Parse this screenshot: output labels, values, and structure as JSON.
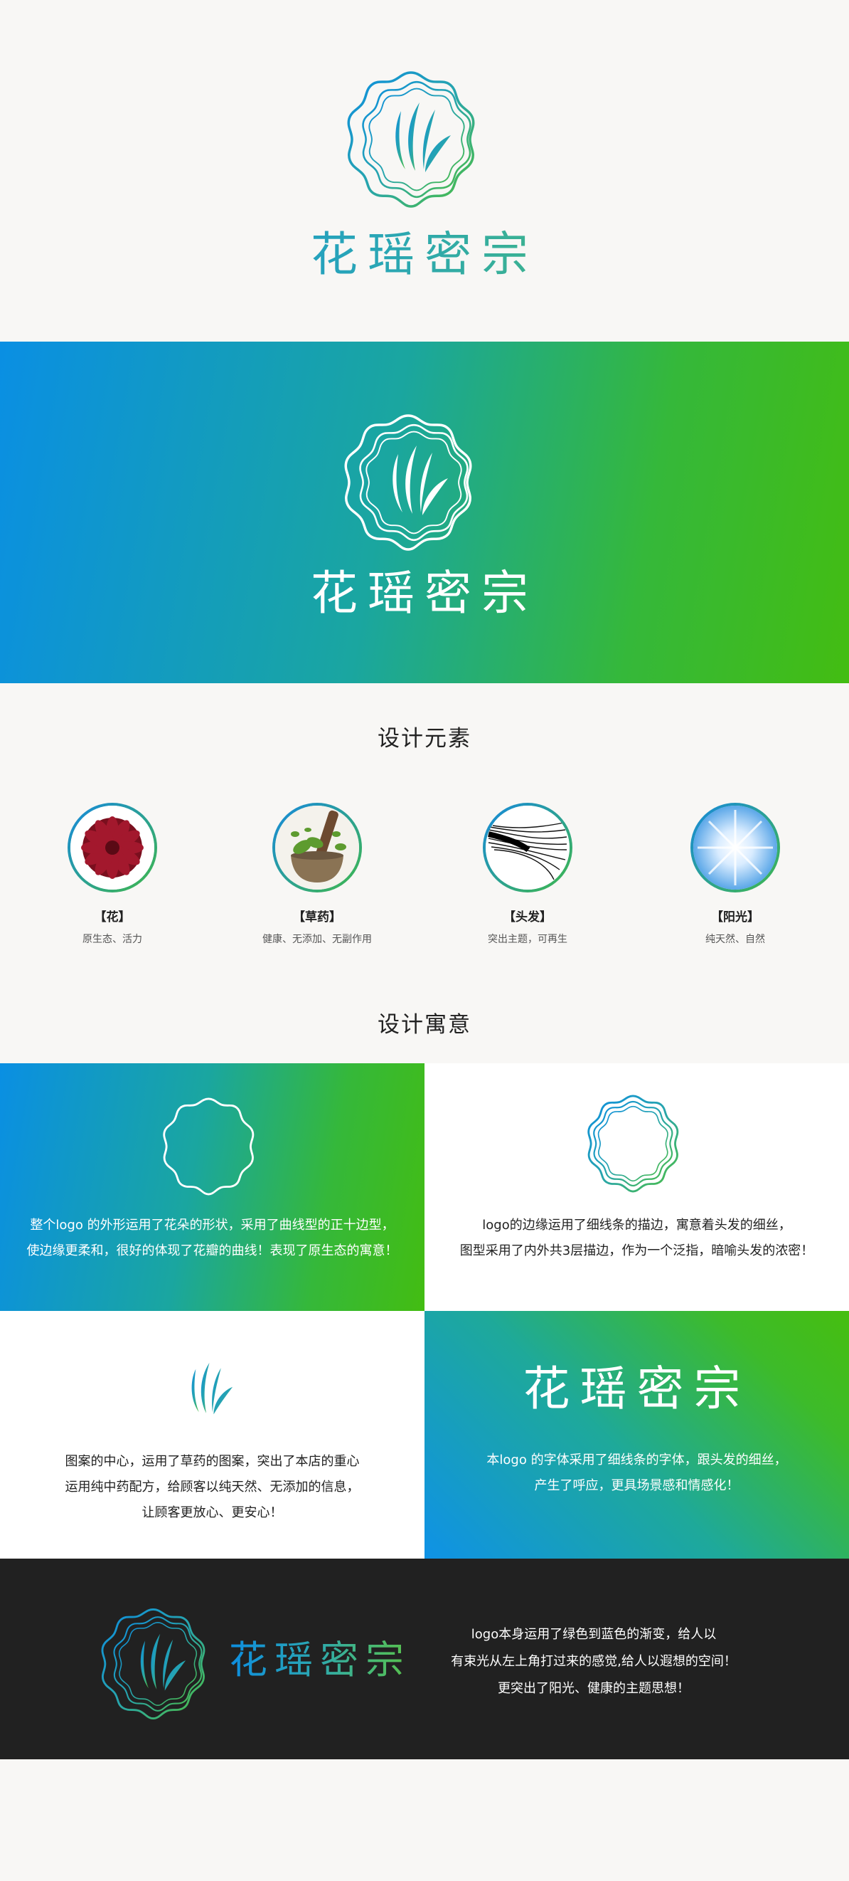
{
  "brand": {
    "name": "花瑶密宗"
  },
  "elements_section": {
    "title": "设计元素",
    "items": [
      {
        "name": "【花】",
        "desc": "原生态、活力"
      },
      {
        "name": "【草药】",
        "desc": "健康、无添加、无副作用"
      },
      {
        "name": "【头发】",
        "desc": "突出主题，可再生"
      },
      {
        "name": "【阳光】",
        "desc": "纯天然、自然"
      }
    ]
  },
  "meaning_section": {
    "title": "设计寓意",
    "panels": [
      {
        "lines": [
          "整个logo 的外形运用了花朵的形状，采用了曲线型的正十边型，",
          "使边缘更柔和，很好的体现了花瓣的曲线！表现了原生态的寓意！"
        ]
      },
      {
        "lines": [
          "logo的边缘运用了细线条的描边，寓意着头发的细丝，",
          "图型采用了内外共3层描边，作为一个泛指，暗喻头发的浓密！"
        ]
      },
      {
        "lines": [
          "图案的中心，运用了草药的图案，突出了本店的重心",
          "运用纯中药配方，给顾客以纯天然、无添加的信息，",
          "让顾客更放心、更安心！"
        ]
      },
      {
        "lines": [
          "本logo 的字体采用了细线条的字体，跟头发的细丝，",
          "产生了呼应，更具场景感和情感化！"
        ]
      }
    ]
  },
  "dark_section": {
    "lines": [
      "logo本身运用了绿色到蓝色的渐变，给人以",
      "有束光从左上角打过来的感觉,给人以遐想的空间！",
      "更突出了阳光、健康的主题思想！"
    ]
  },
  "colors": {
    "blue": "#0a8fe3",
    "green": "#43bd12",
    "dark_bg": "#212121",
    "page_bg": "#f8f7f5"
  }
}
